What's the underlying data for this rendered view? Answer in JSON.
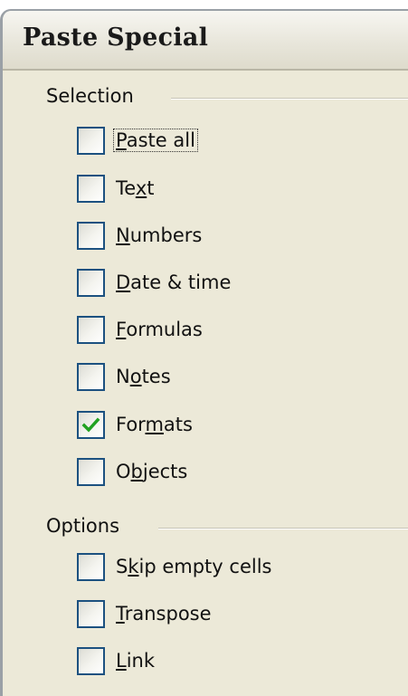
{
  "dialog": {
    "title": "Paste Special"
  },
  "selection": {
    "label": "Selection",
    "items": [
      {
        "pre": "",
        "u": "P",
        "post": "aste all",
        "checked": false,
        "focused": true
      },
      {
        "pre": "Te",
        "u": "x",
        "post": "t",
        "checked": false,
        "focused": false
      },
      {
        "pre": "",
        "u": "N",
        "post": "umbers",
        "checked": false,
        "focused": false
      },
      {
        "pre": "",
        "u": "D",
        "post": "ate & time",
        "checked": false,
        "focused": false
      },
      {
        "pre": "",
        "u": "F",
        "post": "ormulas",
        "checked": false,
        "focused": false
      },
      {
        "pre": "N",
        "u": "o",
        "post": "tes",
        "checked": false,
        "focused": false
      },
      {
        "pre": "For",
        "u": "m",
        "post": "ats",
        "checked": true,
        "focused": false
      },
      {
        "pre": "O",
        "u": "b",
        "post": "jects",
        "checked": false,
        "focused": false
      }
    ]
  },
  "options": {
    "label": "Options",
    "items": [
      {
        "pre": "S",
        "u": "k",
        "post": "ip empty cells",
        "checked": false,
        "focused": false
      },
      {
        "pre": "",
        "u": "T",
        "post": "ranspose",
        "checked": false,
        "focused": false
      },
      {
        "pre": "",
        "u": "L",
        "post": "ink",
        "checked": false,
        "focused": false
      }
    ]
  },
  "colors": {
    "check_mark": "#21a121",
    "checkbox_border": "#1c5180",
    "dialog_face": "#ece9d8"
  }
}
